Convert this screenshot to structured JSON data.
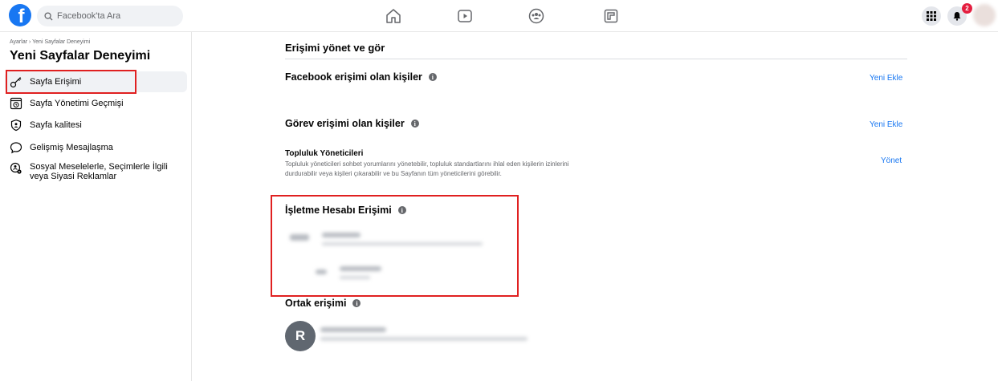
{
  "topbar": {
    "logo": "f",
    "search_placeholder": "Facebook'ta Ara",
    "nav_icons": [
      "home-icon",
      "watch-icon",
      "groups-icon",
      "gaming-icon"
    ],
    "notification_count": "2"
  },
  "sidebar": {
    "breadcrumb": "Ayarlar › Yeni Sayfalar Deneyimi",
    "title": "Yeni Sayfalar Deneyimi",
    "items": [
      {
        "label": "Sayfa Erişimi",
        "icon": "key-icon",
        "active": true
      },
      {
        "label": "Sayfa Yönetimi Geçmişi",
        "icon": "history-icon"
      },
      {
        "label": "Sayfa kalitesi",
        "icon": "shield-icon"
      },
      {
        "label": "Gelişmiş Mesajlaşma",
        "icon": "message-icon"
      },
      {
        "label": "Sosyal Meselelerle, Seçimlerle İlgili veya Siyasi Reklamlar",
        "icon": "ads-settings-icon"
      }
    ]
  },
  "main": {
    "heading": "Erişimi yönet ve gör",
    "facebook_access": {
      "title": "Facebook erişimi olan kişiler",
      "action": "Yeni Ekle"
    },
    "task_access": {
      "title": "Görev erişimi olan kişiler",
      "action": "Yeni Ekle"
    },
    "community": {
      "title": "Topluluk Yöneticileri",
      "description": "Topluluk yöneticileri sohbet yorumlarını yönetebilir, topluluk standartlarını ihlal eden kişilerin izinlerini durdurabilir veya kişileri çıkarabilir ve bu Sayfanın tüm yöneticilerini görebilir.",
      "action": "Yönet"
    },
    "business_access": {
      "title": "İşletme Hesabı Erişimi"
    },
    "shared_access": {
      "title": "Ortak erişimi",
      "avatar_letter": "R"
    }
  },
  "colors": {
    "brand": "#1877f2",
    "highlight": "#e02020",
    "badge": "#e41e3f"
  }
}
